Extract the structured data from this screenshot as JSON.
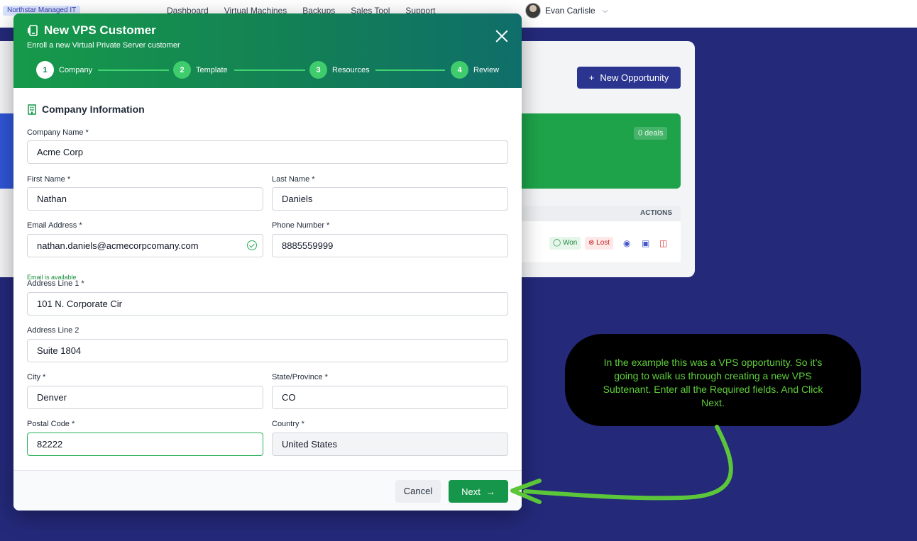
{
  "app": {
    "brand": "Northstar Managed IT",
    "nav": [
      "Dashboard",
      "Virtual Machines",
      "Backups",
      "Sales Tool",
      "Support"
    ],
    "user_name": "Evan Carlisle"
  },
  "background": {
    "new_opportunity_label": "New Opportunity",
    "deals_badge": "0 deals",
    "actions_header": "ACTIONS",
    "won_label": "Won",
    "lost_label": "Lost"
  },
  "modal": {
    "title": "New VPS Customer",
    "subtitle": "Enroll a new Virtual Private Server customer",
    "steps": [
      {
        "num": "1",
        "label": "Company"
      },
      {
        "num": "2",
        "label": "Template"
      },
      {
        "num": "3",
        "label": "Resources"
      },
      {
        "num": "4",
        "label": "Review"
      }
    ],
    "section_title": "Company Information",
    "fields": {
      "company_name": {
        "label": "Company Name *",
        "value": "Acme Corp"
      },
      "first_name": {
        "label": "First Name *",
        "value": "Nathan"
      },
      "last_name": {
        "label": "Last Name *",
        "value": "Daniels"
      },
      "email": {
        "label": "Email Address *",
        "value": "nathan.daniels@acmecorpcomany.com"
      },
      "phone": {
        "label": "Phone Number *",
        "value": "8885559999"
      },
      "address1": {
        "label": "Address Line 1 *",
        "value": "101 N. Corporate Cir"
      },
      "address2": {
        "label": "Address Line 2",
        "value": "Suite 1804"
      },
      "city": {
        "label": "City *",
        "value": "Denver"
      },
      "state": {
        "label": "State/Province *",
        "value": "CO"
      },
      "postal": {
        "label": "Postal Code *",
        "value": "82222"
      },
      "country": {
        "label": "Country *",
        "value": "United States"
      }
    },
    "email_status": "Email is available",
    "cancel_label": "Cancel",
    "next_label": "Next"
  },
  "annotation": {
    "text": "In the example this was a VPS opportunity. So it’s going to walk us through creating a new VPS Subtenant. Enter all the Required fields. And Click Next.",
    "text_color": "#5fcf3b",
    "arrow_color": "#5cc63a"
  }
}
